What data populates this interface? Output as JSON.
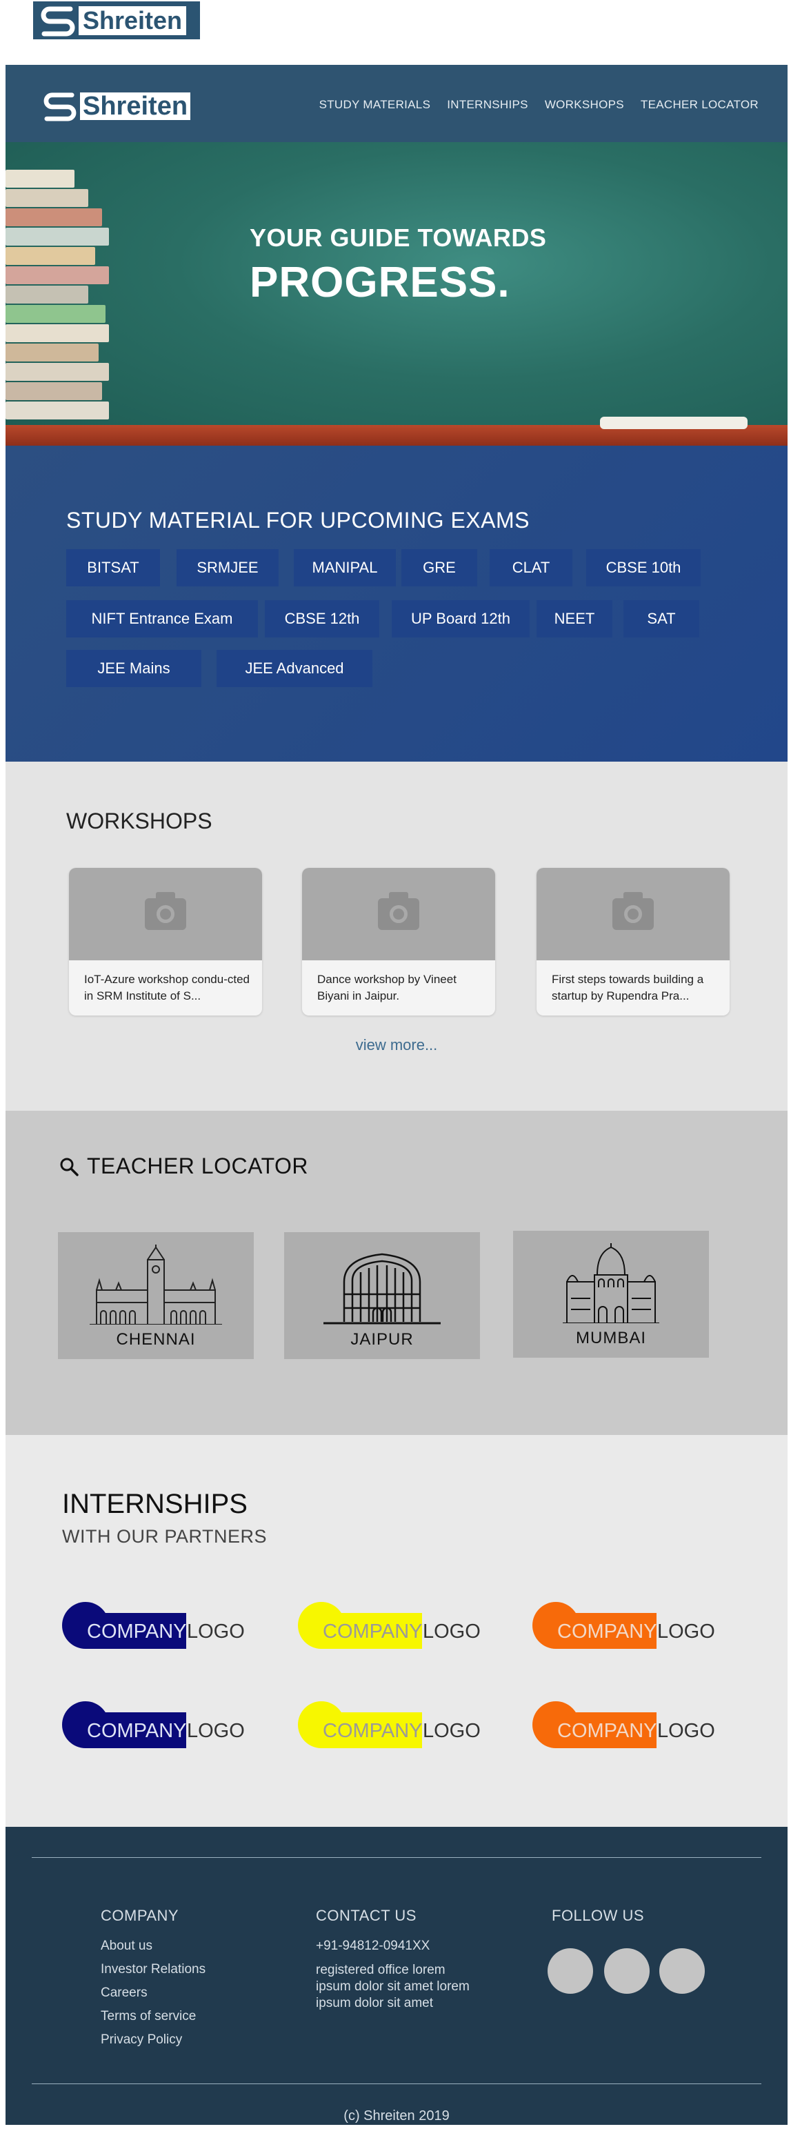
{
  "brand": {
    "name": "Shreiten"
  },
  "nav": [
    "STUDY MATERIALS",
    "INTERNSHIPS",
    "WORKSHOPS",
    "TEACHER LOCATOR"
  ],
  "hero": {
    "line1": "YOUR GUIDE TOWARDS",
    "line2": "PROGRESS."
  },
  "study": {
    "title": "STUDY MATERIAL FOR UPCOMING EXAMS",
    "exams": [
      "BITSAT",
      "SRMJEE",
      "MANIPAL",
      "GRE",
      "CLAT",
      "CBSE 10th",
      "NIFT Entrance Exam",
      "CBSE 12th",
      "UP Board 12th",
      "NEET",
      "SAT",
      "JEE Mains",
      "JEE Advanced"
    ]
  },
  "workshops": {
    "title": "WORKSHOPS",
    "cards": [
      "IoT-Azure workshop condu-cted in SRM Institute of S...",
      "Dance workshop by Vineet Biyani in Jaipur.",
      "First steps towards building a startup by Rupendra Pra..."
    ],
    "view_more": "view more..."
  },
  "teacher": {
    "title": "TEACHER LOCATOR",
    "cities": [
      "CHENNAI",
      "JAIPUR",
      "MUMBAI"
    ]
  },
  "internships": {
    "title": "INTERNSHIPS",
    "subtitle": "WITH OUR PARTNERS",
    "logos": [
      {
        "w1": "COMPANY",
        "w2": "LOGO",
        "color": "#0a0a7a",
        "text_color": "#dfe4f5"
      },
      {
        "w1": "COMPANY",
        "w2": "LOGO",
        "color": "#f7f700",
        "text_color": "#9a9a9a"
      },
      {
        "w1": "COMPANY",
        "w2": "LOGO",
        "color": "#f76a0a",
        "text_color": "#f3d8c6"
      },
      {
        "w1": "COMPANY",
        "w2": "LOGO",
        "color": "#0a0a7a",
        "text_color": "#dfe4f5"
      },
      {
        "w1": "COMPANY",
        "w2": "LOGO",
        "color": "#f7f700",
        "text_color": "#9a9a9a"
      },
      {
        "w1": "COMPANY",
        "w2": "LOGO",
        "color": "#f76a0a",
        "text_color": "#f3d8c6"
      }
    ]
  },
  "footer": {
    "company_title": "COMPANY",
    "company_links": [
      "About us",
      "Investor Relations",
      "Careers",
      "Terms of service",
      "Privacy Policy"
    ],
    "contact_title": "CONTACT US",
    "phone": "+91-94812-0941XX",
    "address": [
      "registered office lorem",
      "ipsum dolor sit amet lorem",
      "ipsum dolor sit amet"
    ],
    "follow_title": "FOLLOW US",
    "copyright": "(c) Shreiten  2019"
  }
}
